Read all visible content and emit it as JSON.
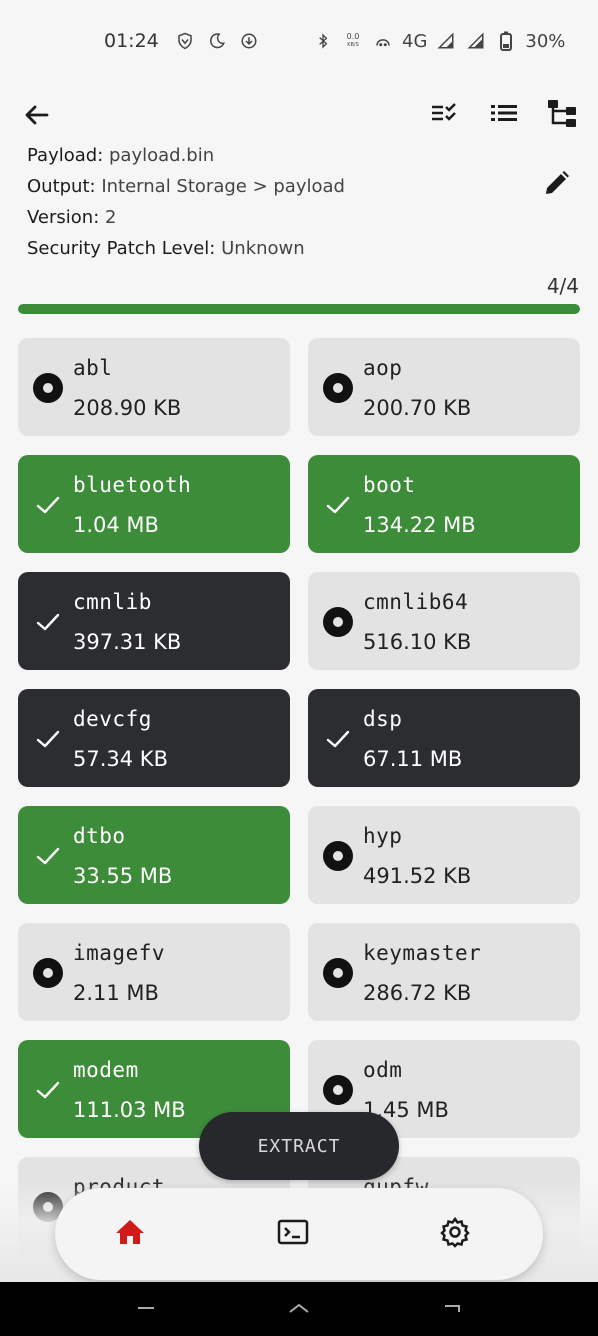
{
  "status_bar": {
    "time": "01:24",
    "data_speed_top": "0.0",
    "data_speed_bottom": "KB/S",
    "network": "4G",
    "battery": "30%"
  },
  "toolbar": {
    "icons": [
      "arrow-left-icon",
      "select-all-icon",
      "list-icon",
      "tree-icon"
    ]
  },
  "info": {
    "payload_key": "Payload:",
    "payload_value": "payload.bin",
    "output_key": "Output:",
    "output_value": "Internal Storage > payload",
    "version_key": "Version:",
    "version_value": "2",
    "patch_key": "Security Patch Level:",
    "patch_value": "Unknown"
  },
  "progress": {
    "text": "4/4",
    "fraction": 1.0
  },
  "partitions": [
    {
      "name": "abl",
      "size": "208.90 KB",
      "state": "unselected"
    },
    {
      "name": "aop",
      "size": "200.70 KB",
      "state": "unselected"
    },
    {
      "name": "bluetooth",
      "size": "1.04 MB",
      "state": "extracted"
    },
    {
      "name": "boot",
      "size": "134.22 MB",
      "state": "extracted"
    },
    {
      "name": "cmnlib",
      "size": "397.31 KB",
      "state": "selected"
    },
    {
      "name": "cmnlib64",
      "size": "516.10 KB",
      "state": "unselected"
    },
    {
      "name": "devcfg",
      "size": "57.34 KB",
      "state": "selected"
    },
    {
      "name": "dsp",
      "size": "67.11 MB",
      "state": "selected"
    },
    {
      "name": "dtbo",
      "size": "33.55 MB",
      "state": "extracted"
    },
    {
      "name": "hyp",
      "size": "491.52 KB",
      "state": "unselected"
    },
    {
      "name": "imagefv",
      "size": "2.11 MB",
      "state": "unselected"
    },
    {
      "name": "keymaster",
      "size": "286.72 KB",
      "state": "unselected"
    },
    {
      "name": "modem",
      "size": "111.03 MB",
      "state": "extracted"
    },
    {
      "name": "odm",
      "size": "1.45 MB",
      "state": "unselected"
    },
    {
      "name": "product",
      "size": "",
      "state": "unselected"
    },
    {
      "name": "qupfw",
      "size": "",
      "state": "unselected"
    }
  ],
  "extract_button": {
    "label": "EXTRACT"
  },
  "bottom_nav": {
    "items": [
      {
        "icon": "home-icon",
        "active": true
      },
      {
        "icon": "terminal-icon",
        "active": false
      },
      {
        "icon": "settings-gear-icon",
        "active": false
      }
    ]
  },
  "colors": {
    "extracted": "#3d8c3a",
    "selected": "#2b2d31",
    "unselected": "#e3e3e3",
    "accent_home": "#d11a1a"
  }
}
